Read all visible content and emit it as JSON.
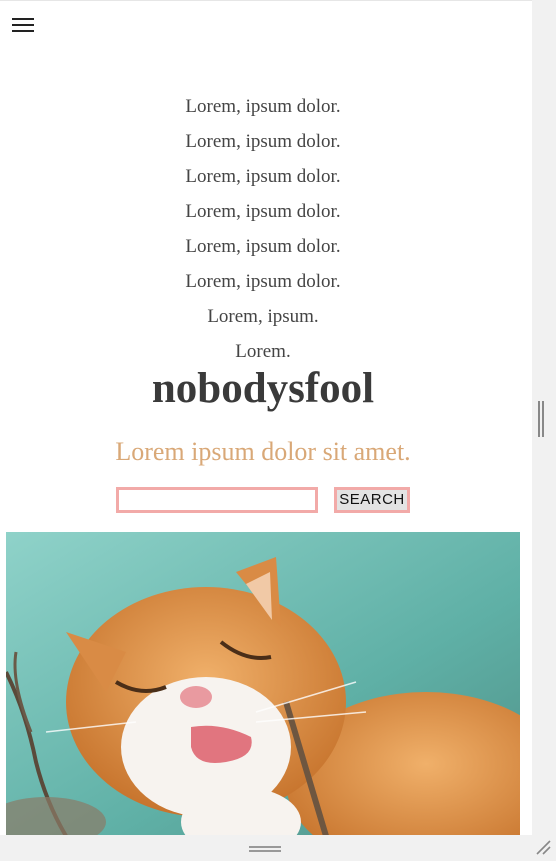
{
  "nav": {
    "menu_items": [
      "Lorem, ipsum dolor.",
      "Lorem, ipsum dolor.",
      "Lorem, ipsum dolor.",
      "Lorem, ipsum dolor.",
      "Lorem, ipsum dolor.",
      "Lorem, ipsum dolor.",
      "Lorem, ipsum.",
      "Lorem."
    ]
  },
  "header": {
    "title": "nobodysfool",
    "tagline": "Lorem ipsum dolor sit amet."
  },
  "search": {
    "value": "",
    "placeholder": "",
    "button_label": "SEARCH"
  },
  "icons": {
    "menu": "hamburger-menu-icon",
    "resize": "resize-grip-icon"
  },
  "colors": {
    "tagline": "#d9a877",
    "search_border": "#f2aaa8",
    "title": "#3a3a3a"
  }
}
